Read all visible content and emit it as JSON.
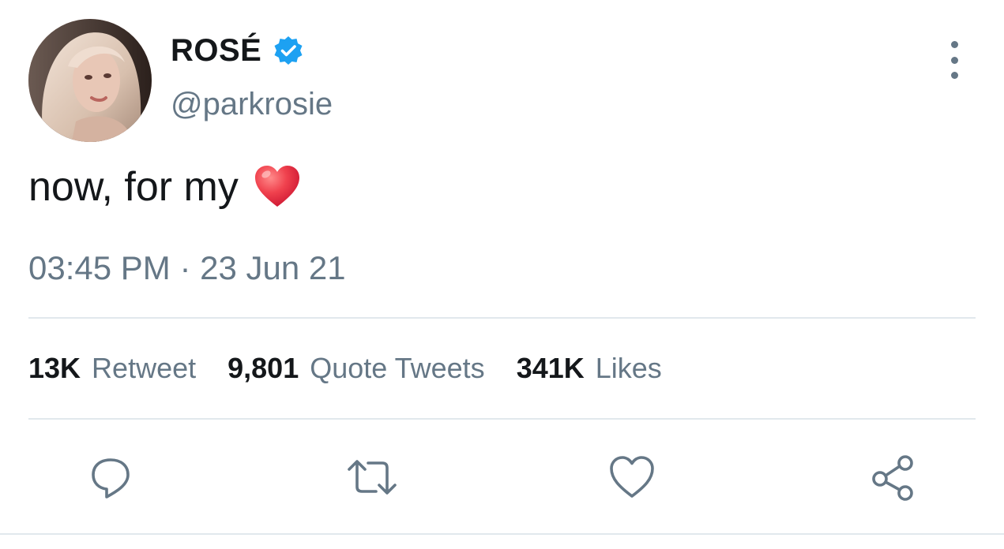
{
  "author": {
    "display_name": "ROSÉ",
    "handle": "@parkrosie",
    "verified_icon": "verified-badge-icon",
    "avatar": "profile-photo"
  },
  "tweet": {
    "text": "now, for my",
    "emoji": "red-heart-emoji",
    "timestamp": "03:45 PM · 23 Jun 21"
  },
  "stats": {
    "retweets_count": "13K",
    "retweets_label": "Retweet",
    "quotes_count": "9,801",
    "quotes_label": "Quote Tweets",
    "likes_count": "341K",
    "likes_label": "Likes"
  },
  "actions": [
    {
      "icon": "reply-icon"
    },
    {
      "icon": "retweet-icon"
    },
    {
      "icon": "like-icon"
    },
    {
      "icon": "share-icon"
    }
  ],
  "colors": {
    "text_primary": "#14171a",
    "text_secondary": "#657786",
    "verified_blue": "#1da1f2",
    "divider": "#e1e8ed",
    "heart_red": "#e0243b"
  }
}
